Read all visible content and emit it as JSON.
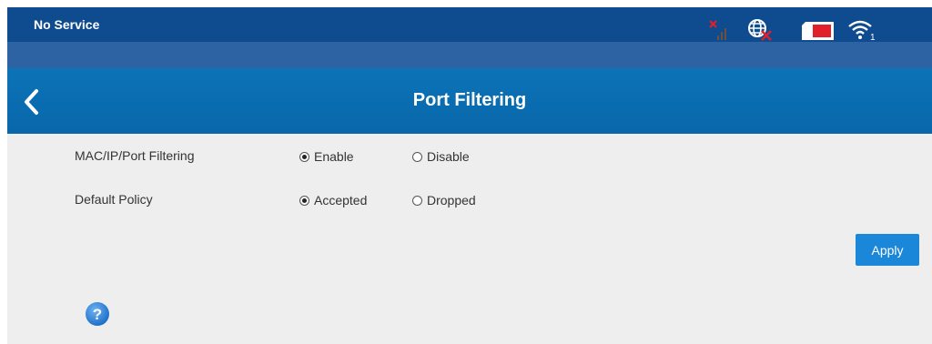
{
  "status_bar": {
    "text": "No Service",
    "icons": [
      "signal-none-icon",
      "globe-disconnected-icon",
      "sim-card-icon",
      "wifi-icon"
    ],
    "wifi_clients": "1"
  },
  "header": {
    "title": "Port Filtering",
    "back_icon": "chevron-left-icon"
  },
  "form": {
    "mac_filtering": {
      "label": "MAC/IP/Port Filtering",
      "options": [
        "Enable",
        "Disable"
      ],
      "selected": "Enable"
    },
    "default_policy": {
      "label": "Default Policy",
      "options": [
        "Accepted",
        "Dropped"
      ],
      "selected": "Accepted"
    },
    "apply_label": "Apply"
  },
  "help": {
    "icon": "question-circle-icon"
  },
  "colors": {
    "status_bar_bg": "#0e4b8f",
    "strip_bg": "#2d63a2",
    "title_bar_bg": "#0b6fb3",
    "content_bg": "#eeeeee",
    "button_blue": "#1a87d8",
    "alert_red": "#e0202a"
  }
}
